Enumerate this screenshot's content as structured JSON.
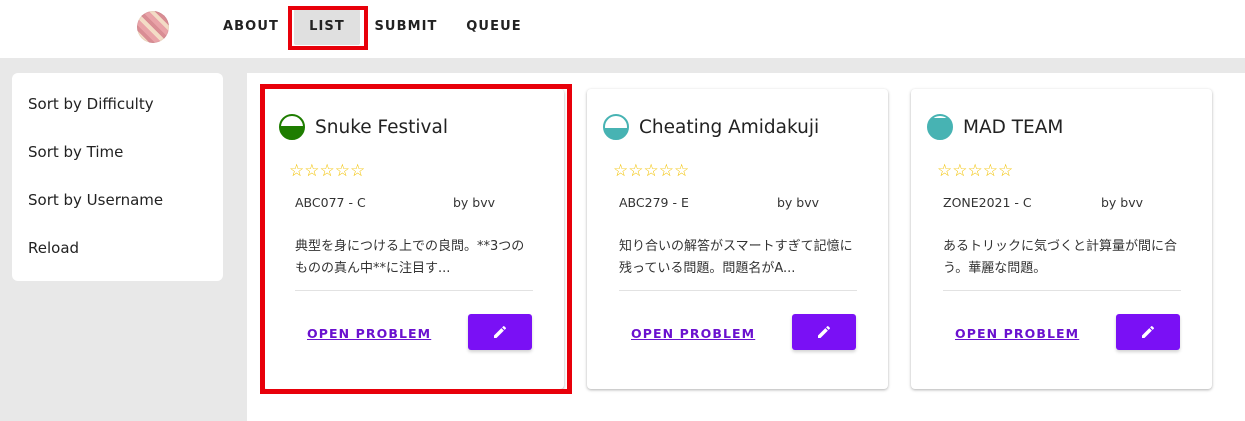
{
  "header": {
    "logo_icon": "striped-circle-logo",
    "nav": [
      {
        "label": "ABOUT"
      },
      {
        "label": "LIST",
        "active": true
      },
      {
        "label": "SUBMIT"
      },
      {
        "label": "QUEUE"
      }
    ]
  },
  "sidebar": {
    "items": [
      {
        "label": "Sort by Difficulty"
      },
      {
        "label": "Sort by Time"
      },
      {
        "label": "Sort by Username"
      },
      {
        "label": "Reload"
      }
    ]
  },
  "cards": [
    {
      "title": "Snuke Festival",
      "difficulty_color": "#1e7d00",
      "difficulty_fill_ratio": 0.55,
      "stars": "☆☆☆☆☆",
      "contest": "ABC077 - C",
      "author": "by bvv",
      "description": "典型を身につける上での良問。**3つのものの真ん中**に注目す...",
      "open_label": "OPEN PROBLEM",
      "edit_icon": "pencil-icon"
    },
    {
      "title": "Cheating Amidakuji",
      "difficulty_color": "#47b3b3",
      "difficulty_fill_ratio": 0.45,
      "stars": "☆☆☆☆☆",
      "contest": "ABC279 - E",
      "author": "by bvv",
      "description": "知り合いの解答がスマートすぎて記憶に残っている問題。問題名がA...",
      "open_label": "OPEN PROBLEM",
      "edit_icon": "pencil-icon"
    },
    {
      "title": "MAD TEAM",
      "difficulty_color": "#47b3b3",
      "difficulty_fill_ratio": 0.9,
      "stars": "☆☆☆☆☆",
      "contest": "ZONE2021 - C",
      "author": "by bvv",
      "description": "あるトリックに気づくと計算量が間に合う。華麗な問題。",
      "open_label": "OPEN PROBLEM",
      "edit_icon": "pencil-icon"
    }
  ],
  "highlight_color": "#e8000a",
  "accent_color": "#7a10f5"
}
